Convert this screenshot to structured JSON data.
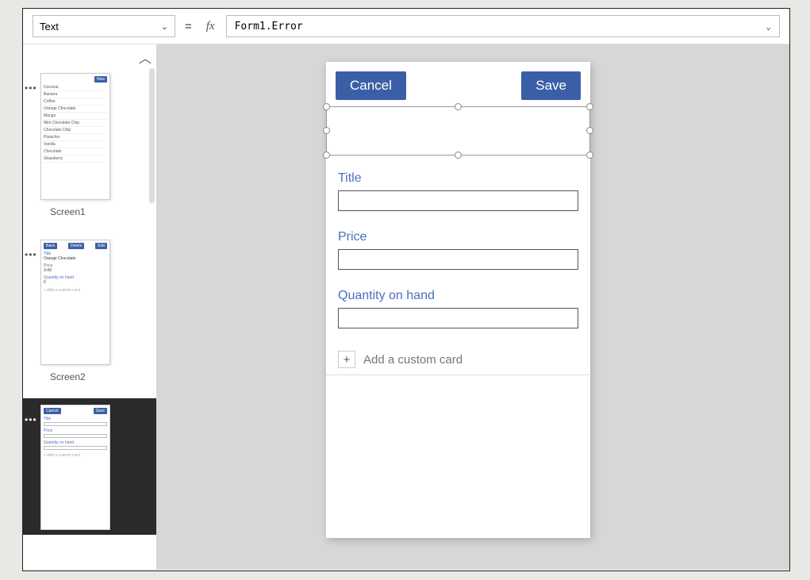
{
  "formula_bar": {
    "property": "Text",
    "equals": "=",
    "fx": "fx",
    "formula": "Form1.Error"
  },
  "thumbnails": {
    "screen1": {
      "label": "Screen1",
      "new_btn": "New",
      "items": [
        "Coconut",
        "Banana",
        "Coffee",
        "Orange Chocolate",
        "Mango",
        "Mint Chocolate Chip",
        "Chocolate Chip",
        "Pistachio",
        "Vanilla",
        "Chocolate",
        "Strawberry"
      ]
    },
    "screen2": {
      "label": "Screen2",
      "back": "Back",
      "delete": "Delete",
      "edit": "Edit",
      "title_lbl": "Title",
      "title_val": "Orange Chocolate",
      "price_lbl": "Price",
      "price_val": "3.49",
      "qty_lbl": "Quantity on hand",
      "qty_val": "0",
      "add_card": "+  Add a custom card"
    },
    "screen3": {
      "cancel": "Cancel",
      "save": "Save",
      "title_lbl": "Title",
      "price_lbl": "Price",
      "qty_lbl": "Quantity on hand",
      "add_card": "+  Add a custom card"
    }
  },
  "designer": {
    "cancel": "Cancel",
    "save": "Save",
    "fields": {
      "title": "Title",
      "price": "Price",
      "qty": "Quantity on hand"
    },
    "add_card": "Add a custom card",
    "plus": "+"
  }
}
